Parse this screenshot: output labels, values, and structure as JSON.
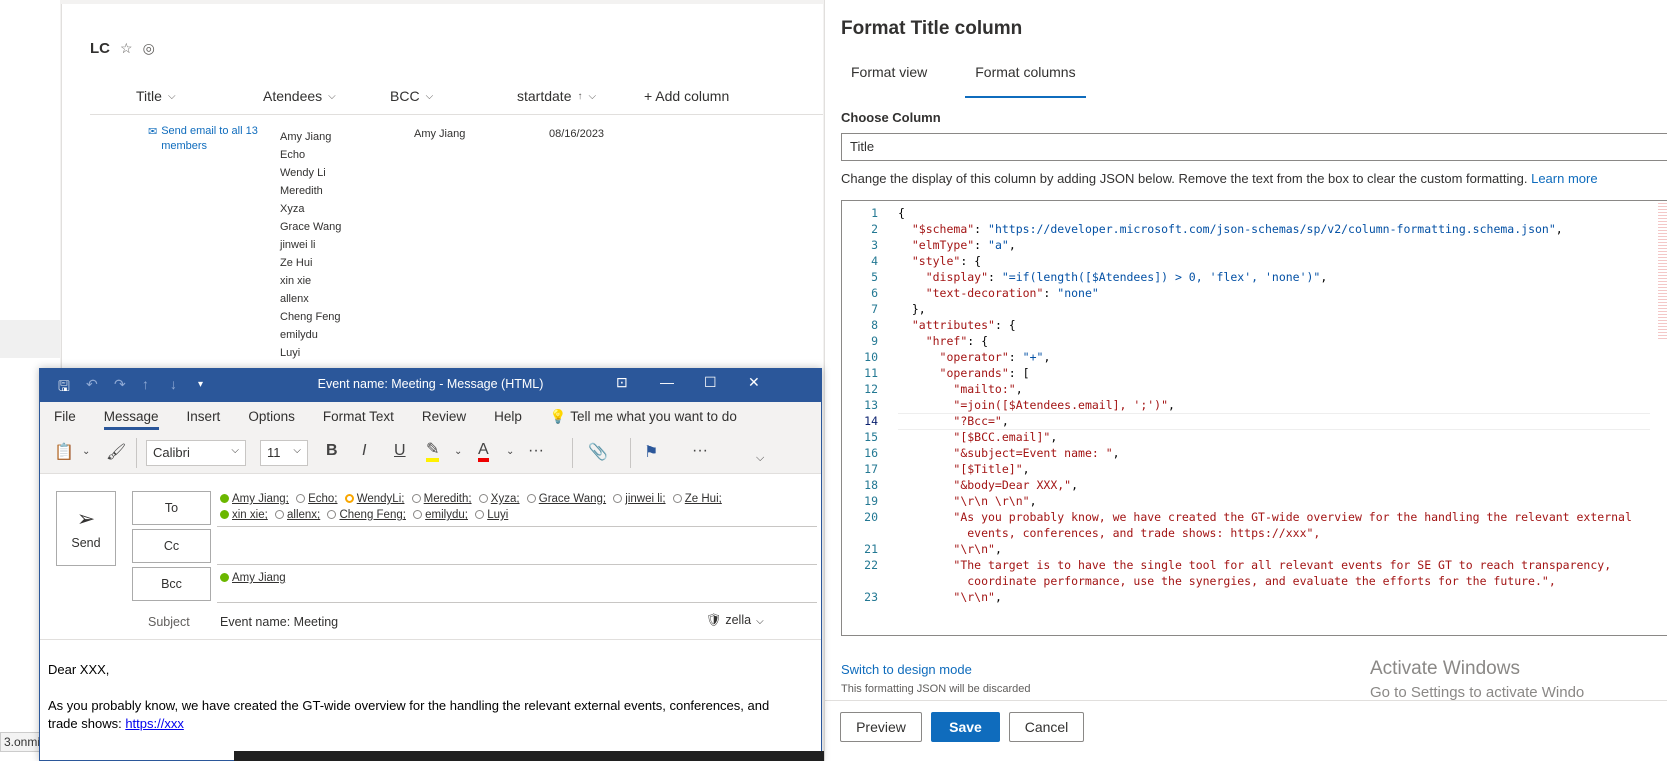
{
  "status_url_fragment": "3.onmic",
  "list": {
    "title": "LC",
    "star_icon": "star-outline",
    "check_icon": "circle-check",
    "columns": [
      "Title",
      "Atendees",
      "BCC",
      "startdate"
    ],
    "add_column": "+ Add column",
    "row": {
      "title_link": "Send email to all 13 members",
      "attendees": [
        "Amy Jiang",
        "Echo",
        "Wendy Li",
        "Meredith",
        "Xyza",
        "Grace Wang",
        "jinwei li",
        "Ze Hui",
        "xin xie",
        "allenx",
        "Cheng Feng",
        "emilydu",
        "Luyi"
      ],
      "bcc": "Amy Jiang",
      "startdate": "08/16/2023"
    }
  },
  "panel": {
    "title": "Format Title column",
    "tabs": [
      "Format view",
      "Format columns"
    ],
    "active_tab": "Format columns",
    "choose_label": "Choose Column",
    "choose_value": "Title",
    "help_text": "Change the display of this column by adding JSON below. Remove the text from the box to clear the custom formatting.",
    "learn_more": "Learn more",
    "switch_design": "Switch to design mode",
    "discard_note": "This formatting JSON will be discarded",
    "buttons": {
      "preview": "Preview",
      "save": "Save",
      "cancel": "Cancel"
    },
    "accent_color": "#0f6cbd"
  },
  "watermark": {
    "line1": "Activate Windows",
    "line2": "Go to Settings to activate Windo"
  },
  "outlook": {
    "window_title": "Event name: Meeting  -  Message (HTML)",
    "menu": [
      "File",
      "Message",
      "Insert",
      "Options",
      "Format Text",
      "Review",
      "Help"
    ],
    "tell_me": "Tell me what you want to do",
    "font": "Calibri",
    "font_size": "11",
    "send": "Send",
    "to_label": "To",
    "cc_label": "Cc",
    "bcc_label": "Bcc",
    "to_recipients": [
      {
        "name": "Amy Jiang;",
        "status": "available"
      },
      {
        "name": "Echo;",
        "status": "offline"
      },
      {
        "name": "WendyLi;",
        "status": "away"
      },
      {
        "name": "Meredith;",
        "status": "offline"
      },
      {
        "name": "Xyza;",
        "status": "offline"
      },
      {
        "name": "Grace Wang;",
        "status": "offline"
      },
      {
        "name": "jinwei li;",
        "status": "offline"
      },
      {
        "name": "Ze Hui;",
        "status": "offline"
      },
      {
        "name": "xin xie;",
        "status": "available"
      },
      {
        "name": "allenx;",
        "status": "offline"
      },
      {
        "name": "Cheng Feng;",
        "status": "offline"
      },
      {
        "name": "emilydu;",
        "status": "offline"
      },
      {
        "name": "Luyi",
        "status": "offline"
      }
    ],
    "bcc_recipient": "Amy Jiang",
    "subject_label": "Subject",
    "subject": "Event name: Meeting",
    "sensitivity": "zella",
    "body_greeting": "Dear XXX,",
    "body_text": "As you probably know, we have created the GT-wide overview for the handling the relevant external events, conferences, and trade shows:",
    "body_link": "https://xxx",
    "brand_color": "#2b579a"
  },
  "code_lines": [
    {
      "n": "1",
      "t": "{"
    },
    {
      "n": "2",
      "t": "  \"$schema\": \"https://developer.microsoft.com/json-schemas/sp/v2/column-formatting.schema.json\","
    },
    {
      "n": "3",
      "t": "  \"elmType\": \"a\","
    },
    {
      "n": "4",
      "t": "  \"style\": {"
    },
    {
      "n": "5",
      "t": "    \"display\": \"=if(length([$Atendees]) > 0, 'flex', 'none')\","
    },
    {
      "n": "6",
      "t": "    \"text-decoration\": \"none\""
    },
    {
      "n": "7",
      "t": "  },"
    },
    {
      "n": "8",
      "t": "  \"attributes\": {"
    },
    {
      "n": "9",
      "t": "    \"href\": {"
    },
    {
      "n": "10",
      "t": "      \"operator\": \"+\","
    },
    {
      "n": "11",
      "t": "      \"operands\": ["
    },
    {
      "n": "12",
      "t": "        \"mailto:\","
    },
    {
      "n": "13",
      "t": "        \"=join([$Atendees.email], ';')\","
    },
    {
      "n": "14",
      "t": "        \"?Bcc=\","
    },
    {
      "n": "15",
      "t": "        \"[$BCC.email]\","
    },
    {
      "n": "16",
      "t": "        \"&subject=Event name: \","
    },
    {
      "n": "17",
      "t": "        \"[$Title]\","
    },
    {
      "n": "18",
      "t": "        \"&body=Dear XXX,\","
    },
    {
      "n": "19",
      "t": "        \"\\r\\n \\r\\n\","
    },
    {
      "n": "20",
      "t": "        \"As you probably know, we have created the GT-wide overview for the handling the relevant external"
    },
    {
      "n": "",
      "t": "          events, conferences, and trade shows: https://xxx\","
    },
    {
      "n": "21",
      "t": "        \"\\r\\n\","
    },
    {
      "n": "22",
      "t": "        \"The target is to have the single tool for all relevant events for SE GT to reach transparency,"
    },
    {
      "n": "",
      "t": "          coordinate performance, use the synergies, and evaluate the efforts for the future.\","
    },
    {
      "n": "23",
      "t": "        \"\\r\\n\","
    }
  ]
}
